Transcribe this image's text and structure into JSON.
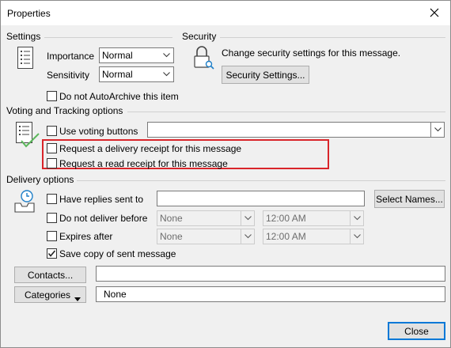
{
  "window": {
    "title": "Properties"
  },
  "settings": {
    "heading": "Settings",
    "importance_label": "Importance",
    "importance_value": "Normal",
    "sensitivity_label": "Sensitivity",
    "sensitivity_value": "Normal",
    "autoarchive_label": "Do not AutoArchive this item",
    "autoarchive_checked": false
  },
  "security": {
    "heading": "Security",
    "description": "Change security settings for this message.",
    "button_label": "Security Settings..."
  },
  "voting": {
    "heading": "Voting and Tracking options",
    "use_voting_label": "Use voting buttons",
    "use_voting_checked": false,
    "voting_value": "",
    "delivery_receipt_label": "Request a delivery receipt for this message",
    "delivery_receipt_checked": false,
    "read_receipt_label": "Request a read receipt for this message",
    "read_receipt_checked": false
  },
  "delivery": {
    "heading": "Delivery options",
    "replies_label": "Have replies sent to",
    "replies_checked": false,
    "replies_value": "",
    "select_names_label": "Select Names...",
    "do_not_deliver_label": "Do not deliver before",
    "do_not_deliver_checked": false,
    "do_not_deliver_date": "None",
    "do_not_deliver_time": "12:00 AM",
    "expires_label": "Expires after",
    "expires_checked": false,
    "expires_date": "None",
    "expires_time": "12:00 AM",
    "save_copy_label": "Save copy of sent message",
    "save_copy_checked": true
  },
  "contacts": {
    "button_label": "Contacts...",
    "value": ""
  },
  "categories": {
    "button_label": "Categories",
    "value": "None"
  },
  "footer": {
    "close_label": "Close"
  },
  "colors": {
    "highlight": "#d9252a",
    "accent": "#0078d7"
  },
  "icons": {
    "close": "close-icon",
    "settings": "list-icon",
    "security": "lock-icon",
    "voting": "checklist-icon",
    "delivery": "clock-tray-icon",
    "dropdown": "chevron-down-icon",
    "check": "checkmark-icon"
  }
}
